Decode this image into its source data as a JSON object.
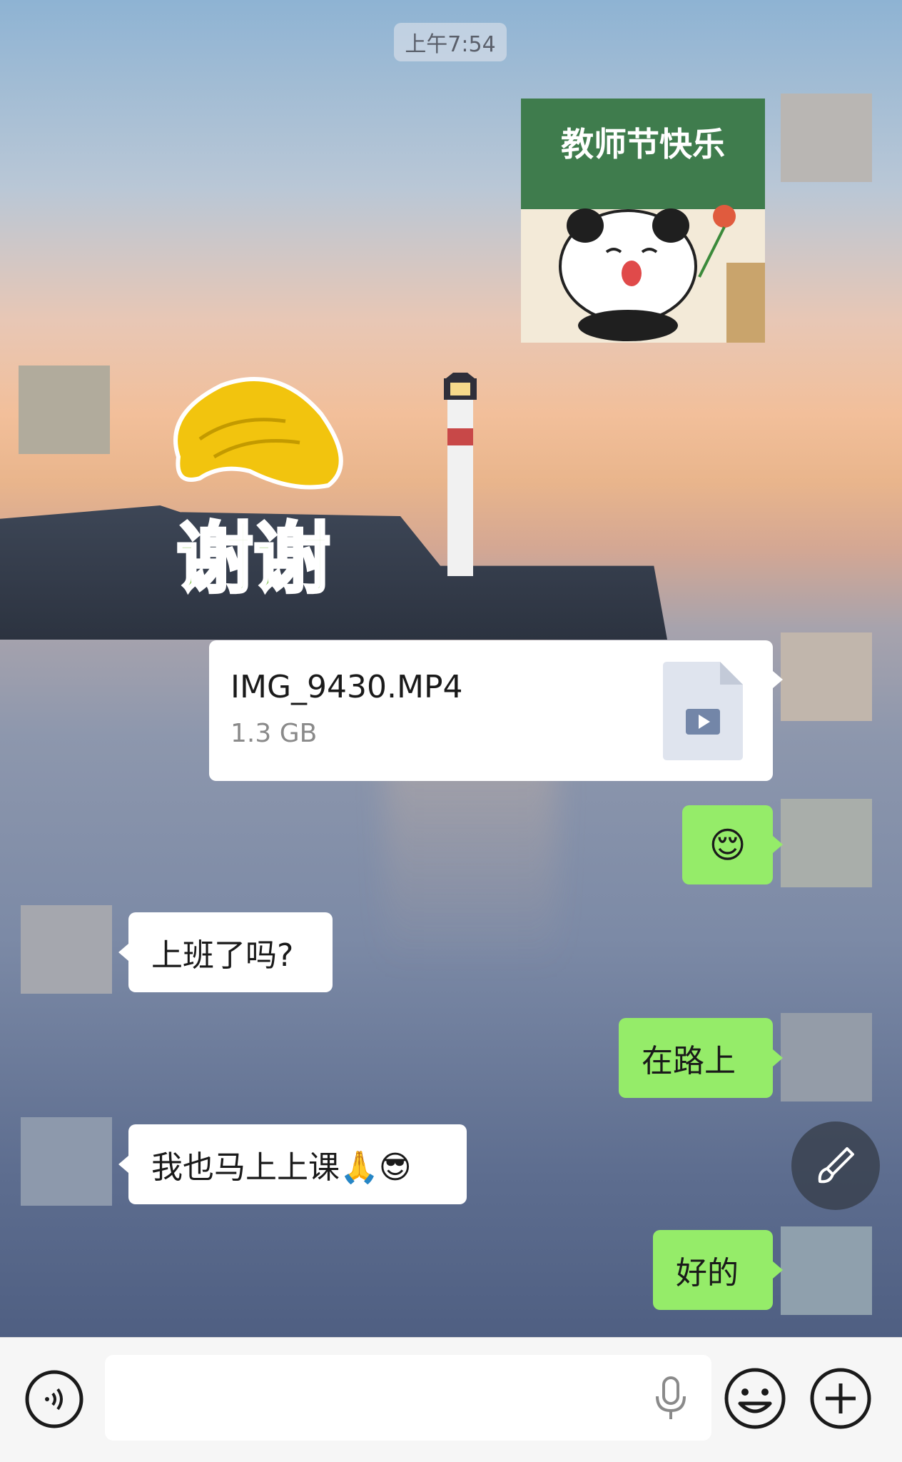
{
  "header": {
    "time": "上午7:54"
  },
  "messages": [
    {
      "side": "right",
      "type": "sticker",
      "sticker_text": "教师节快乐"
    },
    {
      "side": "left",
      "type": "sticker",
      "sticker_text": "谢谢"
    },
    {
      "side": "right",
      "type": "file",
      "file_name": "IMG_9430.MP4",
      "file_size": "1.3 GB"
    },
    {
      "side": "right",
      "type": "emoji",
      "text": "😌"
    },
    {
      "side": "left",
      "type": "text",
      "text": "上班了吗?"
    },
    {
      "side": "right",
      "type": "text",
      "text": "在路上"
    },
    {
      "side": "left",
      "type": "text",
      "text": "我也马上上课🙏😎"
    },
    {
      "side": "right",
      "type": "text",
      "text": "好的"
    }
  ],
  "toolbar": {
    "voice_icon": "voice-toggle-icon",
    "mic_icon": "microphone-icon",
    "emoji_icon": "emoji-face-icon",
    "plus_icon": "plus-icon",
    "fab_icon": "brush-icon"
  },
  "colors": {
    "sent_bubble": "#95ec69",
    "received_bubble": "#ffffff",
    "bottom_bar": "#f6f6f6"
  }
}
